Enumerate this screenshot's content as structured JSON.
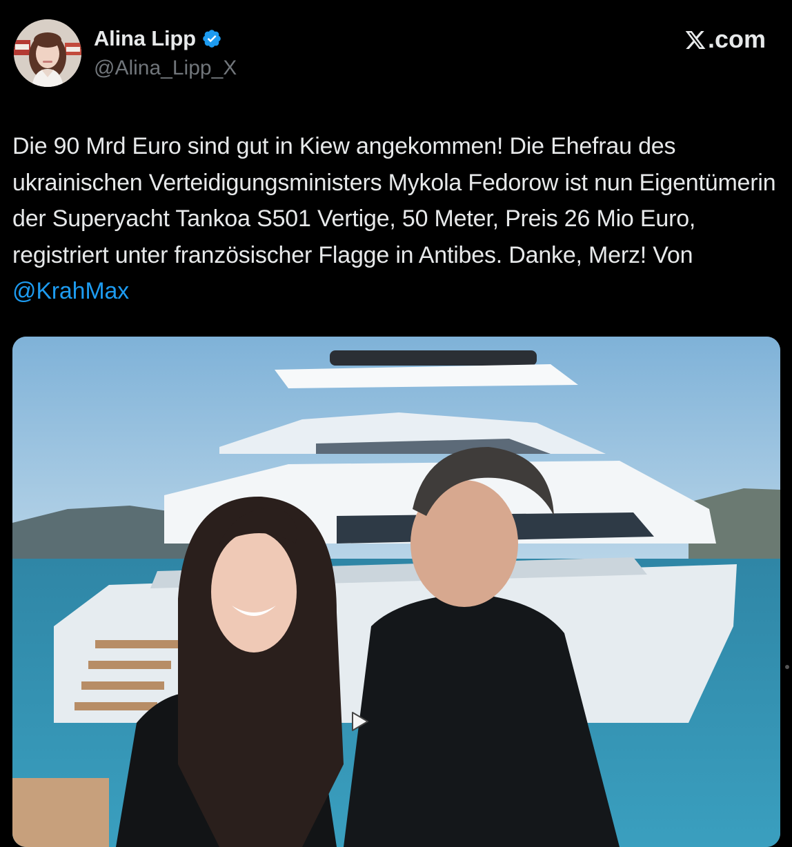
{
  "tweet": {
    "author": {
      "display_name": "Alina Lipp",
      "handle": "@Alina_Lipp_X",
      "verified": true,
      "verified_color": "#1d9bf0"
    },
    "brand": "X.com",
    "text": "Die 90 Mrd Euro sind gut in Kiew angekommen! Die Ehefrau des ukrainischen Verteidigungsministers Mykola Fedorow ist nun Eigentümerin der Superyacht Tankoa S501 Vertige, 50 Meter, Preis 26 Mio Euro, registriert unter französischer Flagge in Antibes. Danke, Merz! Von ",
    "mention": "@KrahMax",
    "mention_color": "#1d9bf0",
    "media": {
      "icon": "play-icon"
    }
  },
  "colors": {
    "background": "#000000",
    "text": "#e7e9ea",
    "secondary_text": "#71767b"
  }
}
